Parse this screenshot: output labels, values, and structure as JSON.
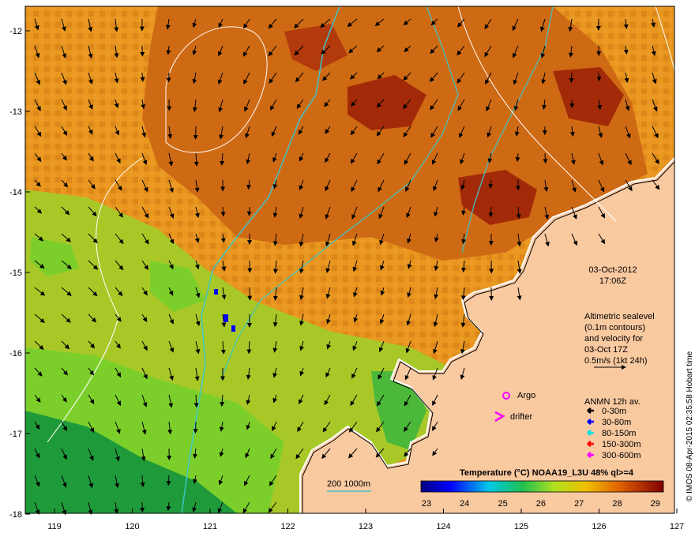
{
  "map": {
    "date": "03-Oct-2012",
    "time": "17:06Z",
    "lon_ticks": [
      "119",
      "120",
      "121",
      "122",
      "123",
      "124",
      "125",
      "126",
      "127"
    ],
    "lat_ticks": [
      "-12",
      "-13",
      "-14",
      "-15",
      "-16",
      "-17",
      "-18"
    ],
    "altimetry_lines": [
      "Altimetric sealevel",
      "(0.1m contours)",
      "and velocity for",
      "03-Oct 17Z",
      "0.5m/s (1kt 24h)"
    ],
    "markers": {
      "argo": "Argo",
      "drifter": "drifter"
    },
    "anmn": {
      "title": "ANMN 12h av.",
      "items": [
        {
          "label": "0-30m",
          "color": "#000000"
        },
        {
          "label": "30-80m",
          "color": "#0000ff"
        },
        {
          "label": "80-150m",
          "color": "#00e0e0"
        },
        {
          "label": "150-300m",
          "color": "#ff0000"
        },
        {
          "label": "300-600m",
          "color": "#ff00ff"
        }
      ]
    },
    "isobath_label": "200  1000m",
    "colorbar": {
      "title": "Temperature (°C) NOAA19_L3U 48% ql>=4",
      "ticks": [
        "23",
        "24",
        "25",
        "26",
        "27",
        "28",
        "29"
      ]
    },
    "credit": "© IMOS 08-Apr-2015 02:35:58 Hobart time",
    "colors": {
      "land": "#f9c9a0",
      "warm": "#d2691e",
      "hot": "#8b1a00",
      "mid": "#e89a20",
      "cool": "#7ccf2a",
      "cold": "#1f9a3a",
      "isobath": "#3ec6c6",
      "contour": "#ffffff"
    }
  }
}
